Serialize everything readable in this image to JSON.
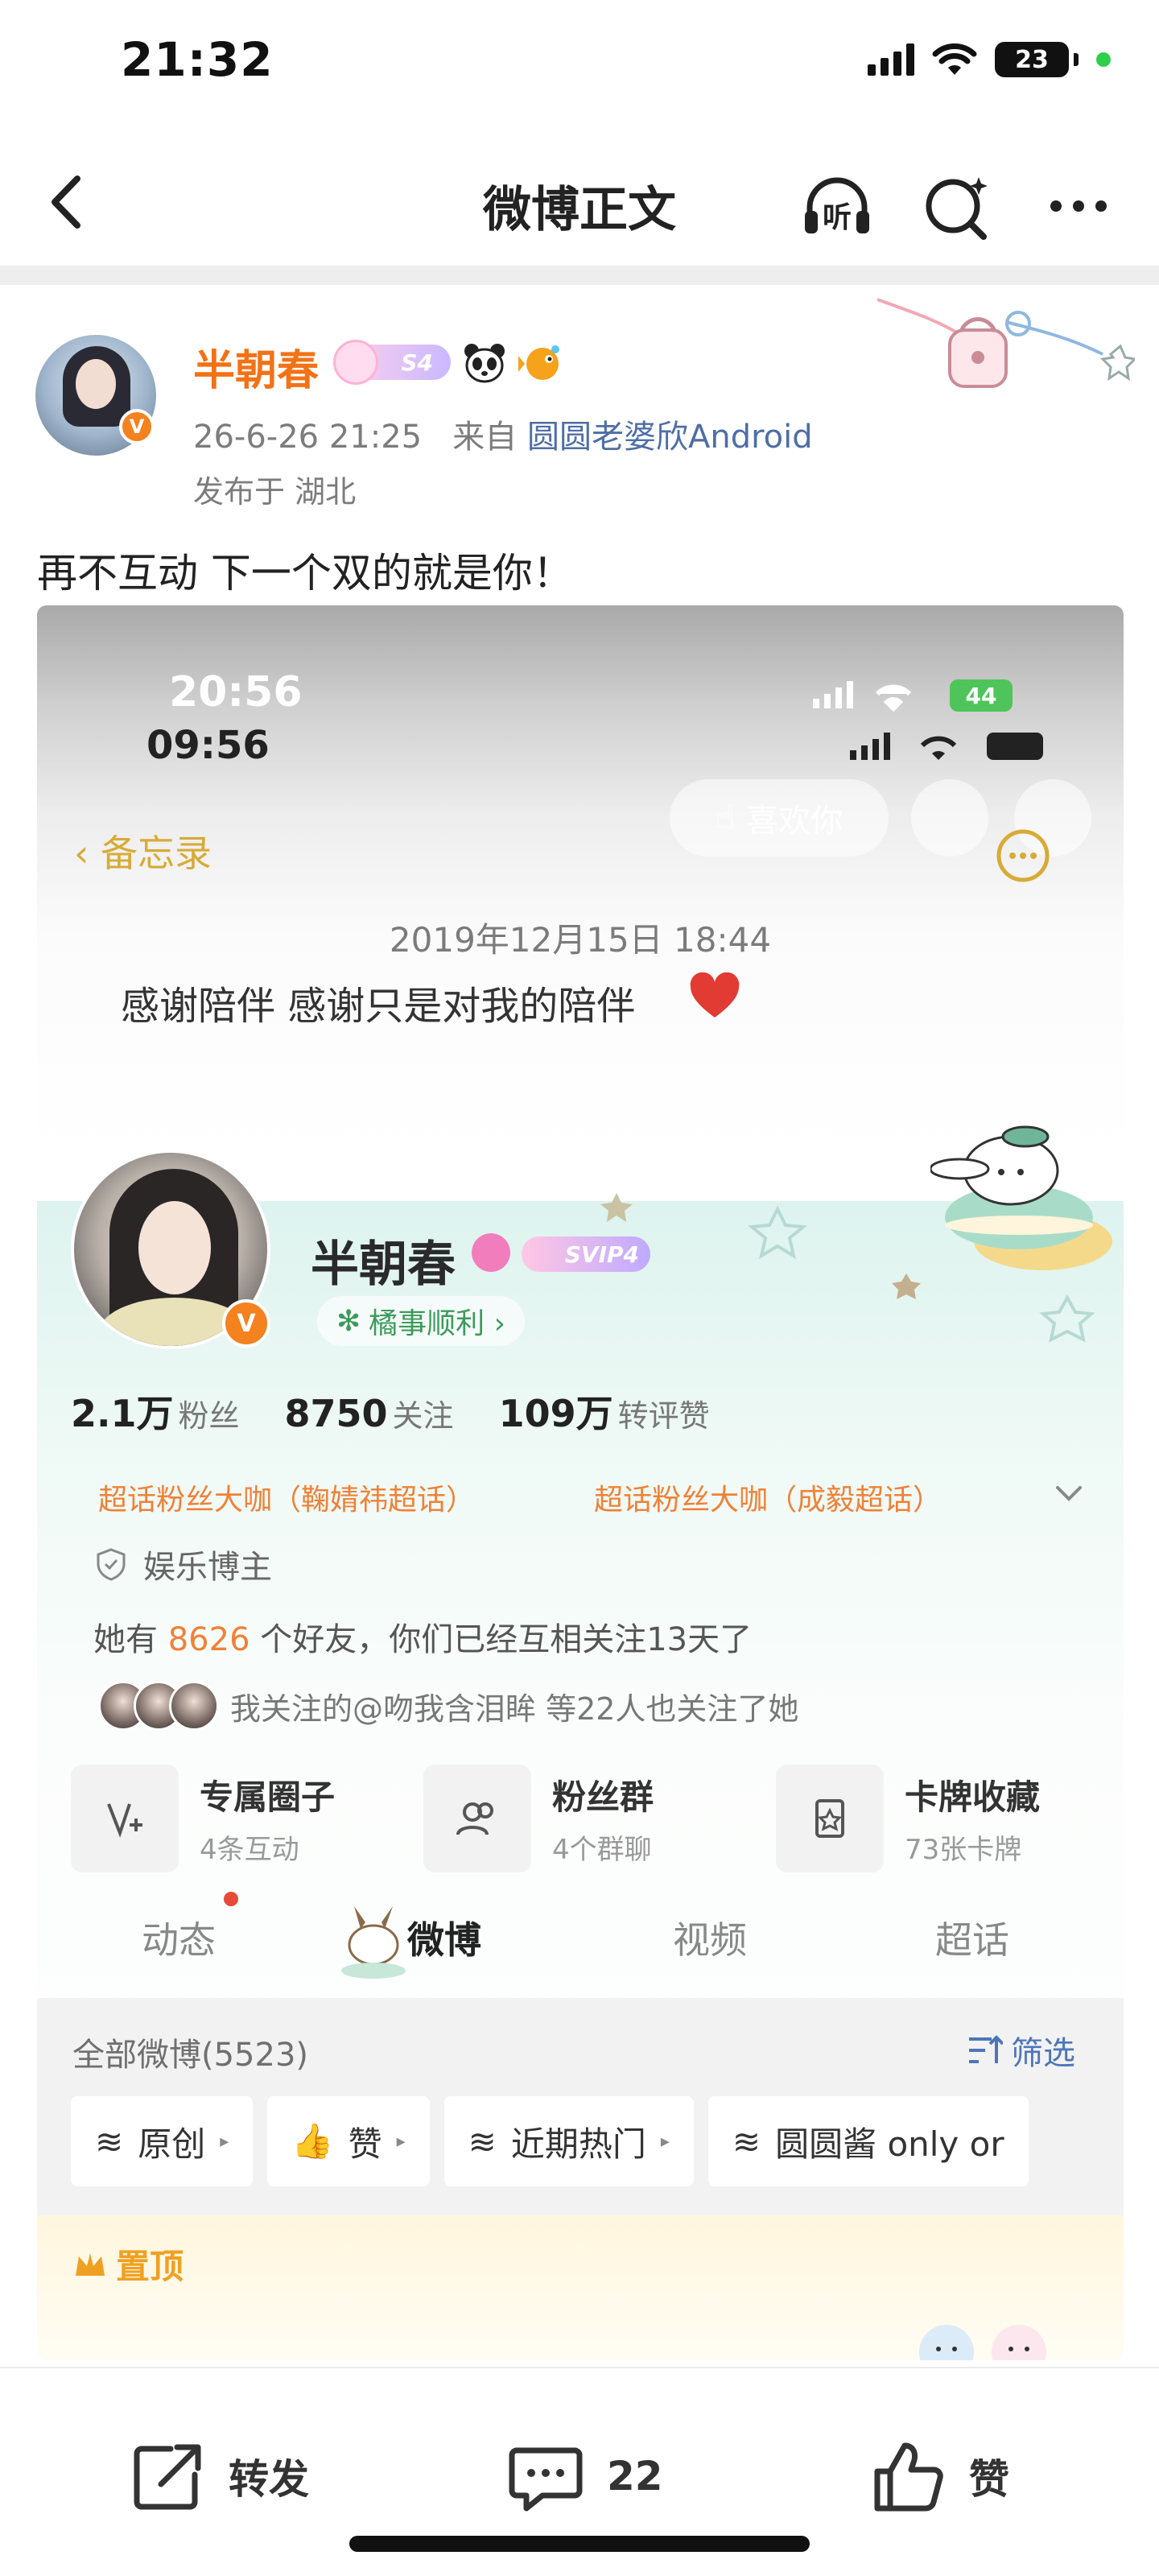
{
  "status_bar": {
    "time": "21:32",
    "battery": "23"
  },
  "nav": {
    "title": "微博正文",
    "listen_label": "听"
  },
  "post": {
    "username": "半朝春",
    "level_badge": "S4",
    "date": "26-6-26 21:25",
    "from_label": "来自",
    "source": "圆圆老婆欣Android",
    "location": "发布于 湖北",
    "text": "再不互动 下一个双的就是你！"
  },
  "screenshot": {
    "time_overlay": "20:56",
    "time": "09:56",
    "battery": "44",
    "back_label": "备忘录",
    "like_pill": "喜欢你",
    "memo_date": "2019年12月15日 18:44",
    "memo_text": "感谢陪伴 感谢只是对我的陪伴",
    "profile": {
      "name": "半朝春",
      "svip": "SVIP4",
      "tag": "橘事顺利 ›",
      "stats": [
        {
          "num": "2.1万",
          "label": "粉丝"
        },
        {
          "num": "8750",
          "label": "关注"
        },
        {
          "num": "109万",
          "label": "转评赞"
        }
      ],
      "supertopics": [
        "超话粉丝大咖（鞠婧祎超话）",
        "超话粉丝大咖（成毅超话）"
      ],
      "category": "娱乐博主",
      "friends_prefix": "她有",
      "friends_count": "8626",
      "friends_suffix": "个好友，你们已经互相关注13天了",
      "mutual_text": "我关注的@吻我含泪眸 等22人也关注了她",
      "cards": [
        {
          "title": "专属圈子",
          "sub": "4条互动"
        },
        {
          "title": "粉丝群",
          "sub": "4个群聊"
        },
        {
          "title": "卡牌收藏",
          "sub": "73张卡牌"
        }
      ],
      "tabs": [
        "动态",
        "微博",
        "视频",
        "超话"
      ],
      "all_posts": "全部微博(5523)",
      "filter": "筛选",
      "chips": [
        "原创",
        "赞",
        "近期热门",
        "圆圆酱 only or"
      ],
      "pinned": "置顶"
    }
  },
  "bottom": {
    "repost": "转发",
    "comments": "22",
    "like": "赞"
  },
  "colors": {
    "accent_orange": "#f37216",
    "link_blue": "#4e6ea6",
    "verified": "#f4821f"
  }
}
